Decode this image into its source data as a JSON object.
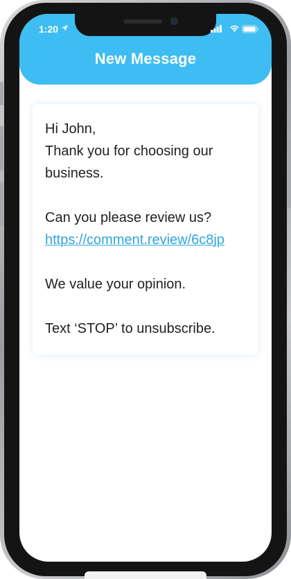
{
  "status_bar": {
    "time": "1:20",
    "icons": [
      "location-arrow-icon",
      "cellular-signal-icon",
      "wifi-icon",
      "battery-icon"
    ]
  },
  "header": {
    "title": "New Message",
    "background_color": "#3dbdf2"
  },
  "message": {
    "greeting": "Hi John,",
    "line_1": "Thank you for choosing our",
    "line_2": "business.",
    "review_request": "Can you please review us?",
    "review_link": "https://comment.review/6c8jp",
    "value_line": "We value your opinion.",
    "unsubscribe_line": "Text ‘STOP’ to unsubscribe.",
    "link_color": "#2fa6dd"
  }
}
